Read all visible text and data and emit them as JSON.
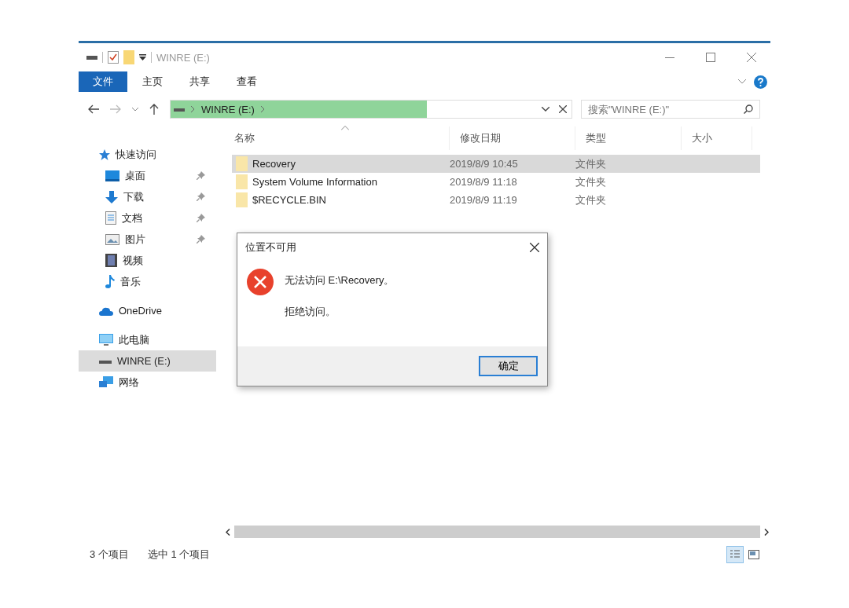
{
  "window": {
    "title": "WINRE (E:)"
  },
  "ribbon_tabs": [
    {
      "label": "文件",
      "selected": true
    },
    {
      "label": "主页",
      "selected": false
    },
    {
      "label": "共享",
      "selected": false
    },
    {
      "label": "查看",
      "selected": false
    }
  ],
  "address_bar": {
    "path": [
      "WINRE (E:)"
    ],
    "level": 0.64
  },
  "search": {
    "placeholder": "搜索\"WINRE (E:)\""
  },
  "sidebar": {
    "items": [
      {
        "label": "快速访问",
        "kind": "star",
        "selected": false,
        "children": [
          {
            "label": "桌面",
            "kind": "desktop",
            "pinned": true
          },
          {
            "label": "下载",
            "kind": "download",
            "pinned": true
          },
          {
            "label": "文档",
            "kind": "document",
            "pinned": true
          },
          {
            "label": "图片",
            "kind": "pictures",
            "pinned": true
          },
          {
            "label": "视频",
            "kind": "video",
            "pinned": false
          },
          {
            "label": "音乐",
            "kind": "music",
            "pinned": false
          }
        ]
      },
      {
        "label": "OneDrive",
        "kind": "cloud",
        "selected": false
      },
      {
        "label": "此电脑",
        "kind": "computer",
        "selected": false
      },
      {
        "label": "WINRE (E:)",
        "kind": "drive",
        "selected": true
      },
      {
        "label": "网络",
        "kind": "network",
        "selected": false
      }
    ]
  },
  "table": {
    "columns": [
      {
        "label": "名称",
        "sorted": true
      },
      {
        "label": "修改日期",
        "sorted": false
      },
      {
        "label": "类型",
        "sorted": false
      },
      {
        "label": "大小",
        "sorted": false
      }
    ],
    "rows": [
      {
        "name": "Recovery",
        "date": "2019/8/9 10:45",
        "type": "文件夹",
        "selected": true
      },
      {
        "name": "System Volume Information",
        "date": "2019/8/9 11:18",
        "type": "文件夹",
        "selected": false
      },
      {
        "name": "$RECYCLE.BIN",
        "date": "2019/8/9 11:19",
        "type": "文件夹",
        "selected": false
      }
    ]
  },
  "status_bar": {
    "item_count": "3 个项目",
    "selection": "选中 1 个项目",
    "views": [
      {
        "kind": "details",
        "selected": true
      },
      {
        "kind": "large",
        "selected": false
      }
    ]
  },
  "dialog": {
    "title": "位置不可用",
    "message": "无法访问 E:\\Recovery。",
    "detail": "拒绝访问。",
    "button": "确定"
  }
}
